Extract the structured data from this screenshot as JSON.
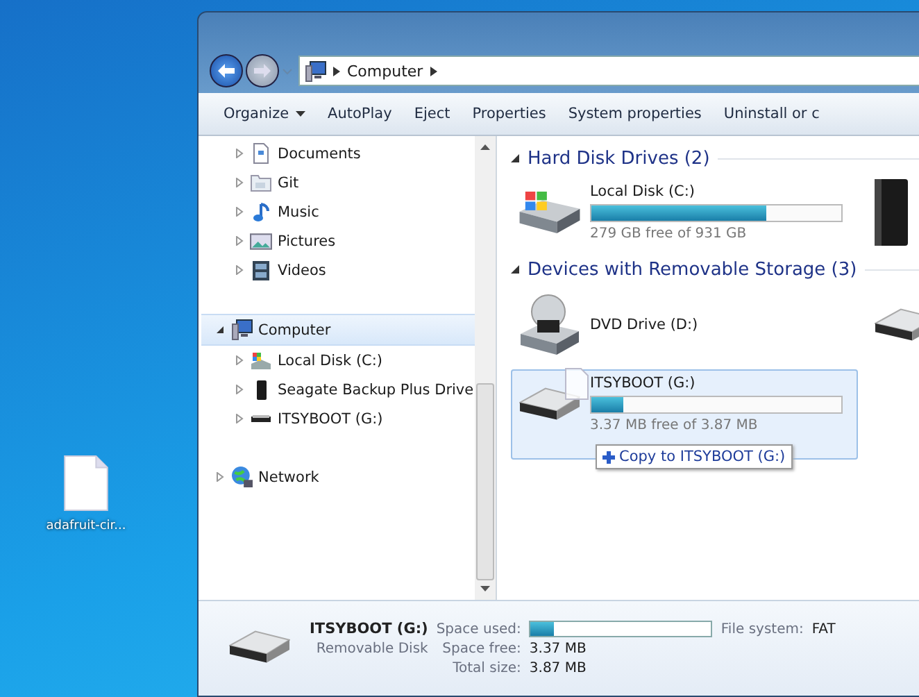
{
  "desktop_icons": [
    {
      "label": "adafruit-cir..."
    }
  ],
  "address_bar": {
    "segments": [
      "Computer"
    ]
  },
  "toolbar": [
    {
      "label": "Organize",
      "dropdown": true
    },
    {
      "label": "AutoPlay",
      "dropdown": false
    },
    {
      "label": "Eject",
      "dropdown": false
    },
    {
      "label": "Properties",
      "dropdown": false
    },
    {
      "label": "System properties",
      "dropdown": false
    },
    {
      "label": "Uninstall or c",
      "dropdown": false
    }
  ],
  "nav_tree": [
    {
      "children": [
        {
          "label": "Documents",
          "kind": "documents",
          "expanded": false,
          "selected": false
        },
        {
          "label": "Git",
          "kind": "folder",
          "expanded": false,
          "selected": false
        },
        {
          "label": "Music",
          "kind": "music",
          "expanded": false,
          "selected": false
        },
        {
          "label": "Pictures",
          "kind": "pictures",
          "expanded": false,
          "selected": false
        },
        {
          "label": "Videos",
          "kind": "videos",
          "expanded": false,
          "selected": false
        }
      ]
    },
    {
      "label": "Computer",
      "kind": "computer",
      "expanded": true,
      "selected": true,
      "children": [
        {
          "label": "Local Disk (C:)",
          "kind": "hdd",
          "expanded": false,
          "selected": false
        },
        {
          "label": "Seagate Backup Plus Drive",
          "kind": "external",
          "expanded": false,
          "selected": false
        },
        {
          "label": "ITSYBOOT (G:)",
          "kind": "usb",
          "expanded": false,
          "selected": false
        }
      ]
    },
    {
      "label": "Network",
      "kind": "network",
      "expanded": false,
      "selected": false
    }
  ],
  "groups": [
    {
      "title": "Hard Disk Drives (2)",
      "expanded": true,
      "items": [
        {
          "kind": "hdd",
          "name": "Local Disk (C:)",
          "level": 0.7,
          "free": "279 GB free of 931 GB",
          "selected": false
        },
        {
          "kind": "external",
          "selected": false
        }
      ]
    },
    {
      "title": "Devices with Removable Storage (3)",
      "expanded": true,
      "items": [
        {
          "kind": "dvd",
          "name": "DVD Drive (D:)",
          "selected": false
        },
        {
          "kind": "usb",
          "selected": false
        },
        {
          "kind": "usb",
          "name": "ITSYBOOT (G:)",
          "level": 0.13,
          "free": "3.37 MB free of 3.87 MB",
          "selected": true,
          "drop_tip": "Copy to ITSYBOOT (G:)"
        }
      ]
    }
  ],
  "details": {
    "kind": "usb",
    "name": "ITSYBOOT (G:)",
    "type": "Removable Disk",
    "space_used_label": "Space used:",
    "level": 0.13,
    "fs_label": "File system:",
    "fs_value": "FAT",
    "free_label": "Space free:",
    "free_value": "3.37 MB",
    "total_label": "Total size:",
    "total_value": "3.87 MB"
  }
}
